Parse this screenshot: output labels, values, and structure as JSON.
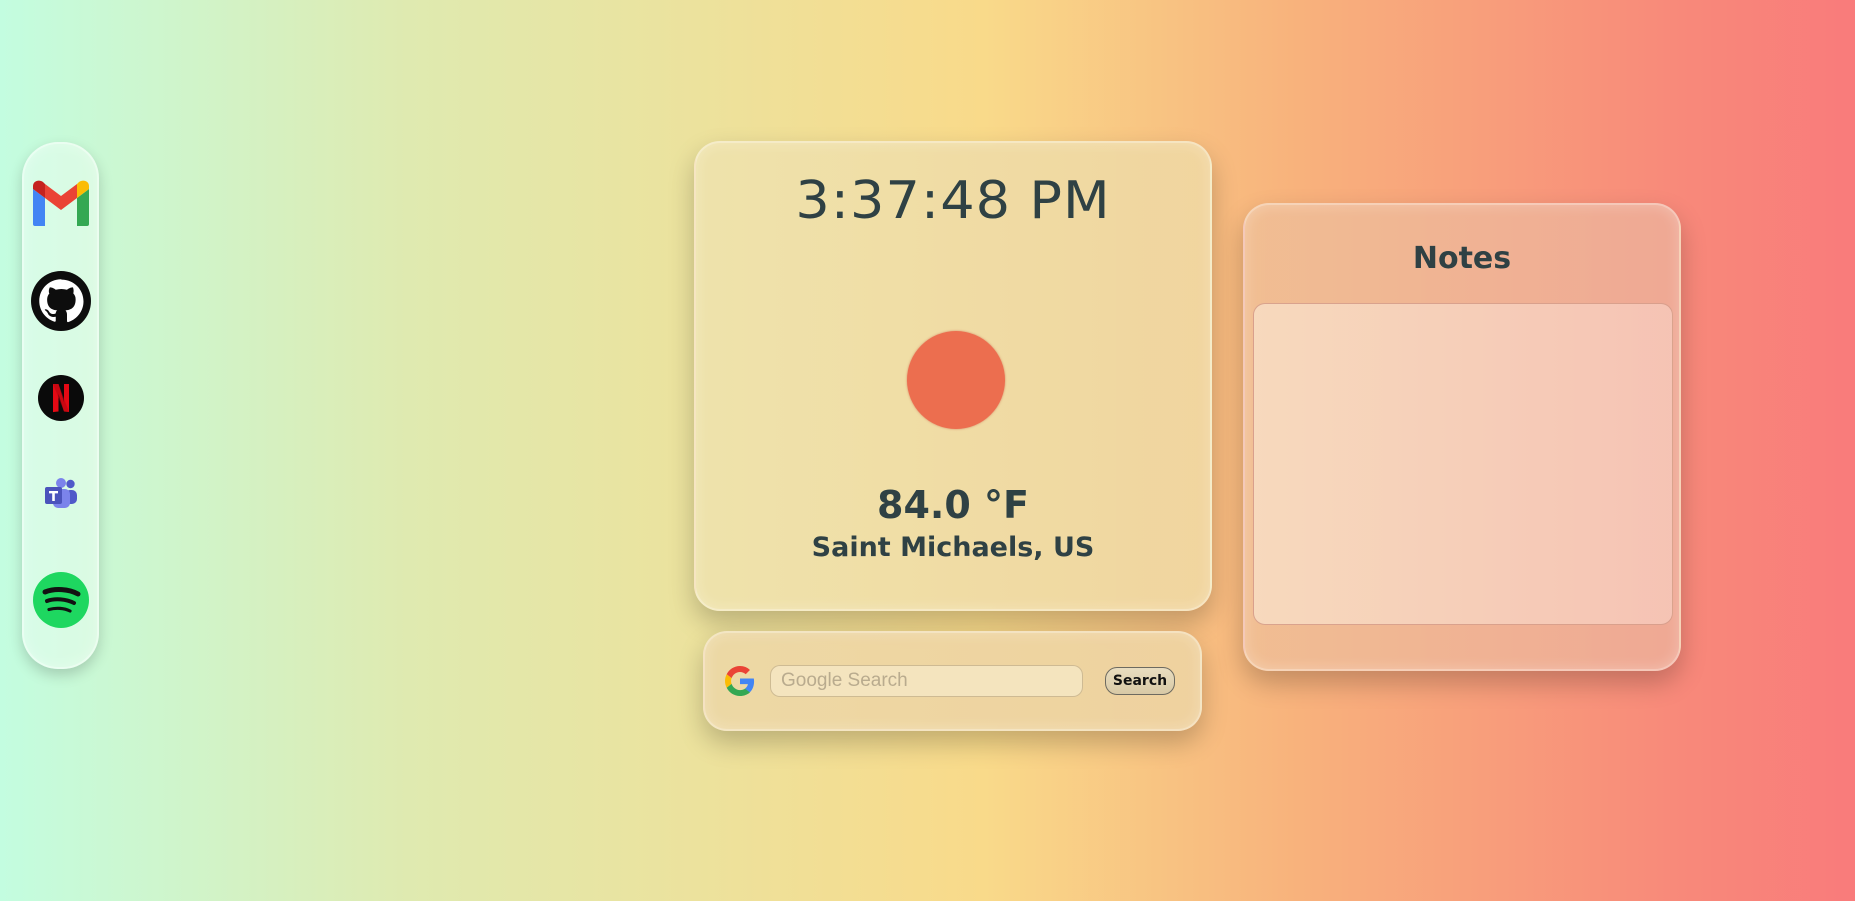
{
  "dock": {
    "items": [
      {
        "name": "gmail",
        "icon": "gmail-icon"
      },
      {
        "name": "github",
        "icon": "github-icon"
      },
      {
        "name": "netflix",
        "icon": "netflix-icon"
      },
      {
        "name": "teams",
        "icon": "teams-icon"
      },
      {
        "name": "spotify",
        "icon": "spotify-icon"
      }
    ]
  },
  "clock": {
    "time": "3:37:48 PM"
  },
  "weather": {
    "icon": "sun-icon",
    "icon_color": "#ec6e4f",
    "temperature": "84.0 °F",
    "location": "Saint Michaels, US"
  },
  "search": {
    "icon": "google-icon",
    "placeholder": "Google Search",
    "value": "",
    "button_label": "Search"
  },
  "notes": {
    "title": "Notes",
    "content": ""
  },
  "colors": {
    "text": "#2f4144",
    "gradient": [
      "#c3fde0",
      "#f9da8a",
      "#f97b7b"
    ]
  }
}
